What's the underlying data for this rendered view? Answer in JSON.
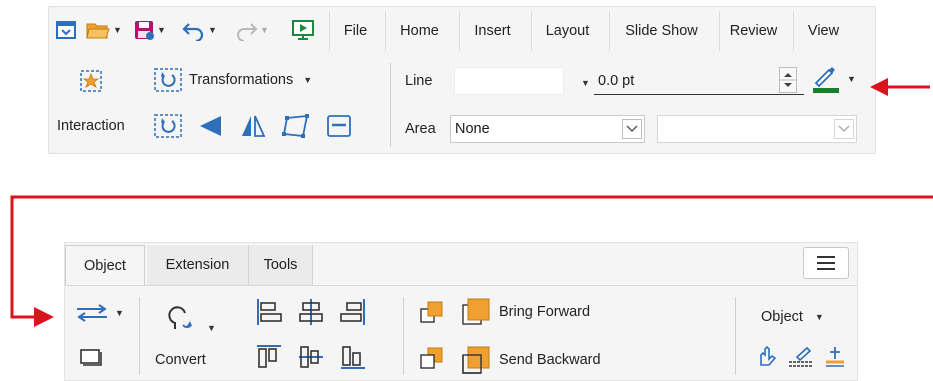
{
  "top_toolbar": {
    "tabs": [
      "File",
      "Home",
      "Insert",
      "Layout",
      "Slide Show",
      "Review",
      "View"
    ],
    "interaction_label": "Interaction",
    "transformations_label": "Transformations",
    "line_label": "Line",
    "line_width_value": "0.0 pt",
    "line_style_value": "",
    "area_label": "Area",
    "area_value": "None",
    "area_secondary_value": ""
  },
  "bottom_toolbar": {
    "tabs": [
      "Object",
      "Extension",
      "Tools"
    ],
    "active_tab": "Object",
    "convert_label": "Convert",
    "bring_forward_label": "Bring Forward",
    "send_backward_label": "Send Backward",
    "object_menu_label": "Object"
  },
  "colors": {
    "accent_blue": "#2f6fba",
    "orange": "#f0a030",
    "red_arrow": "#d9141e",
    "line_color_green": "#1a7f2b"
  }
}
